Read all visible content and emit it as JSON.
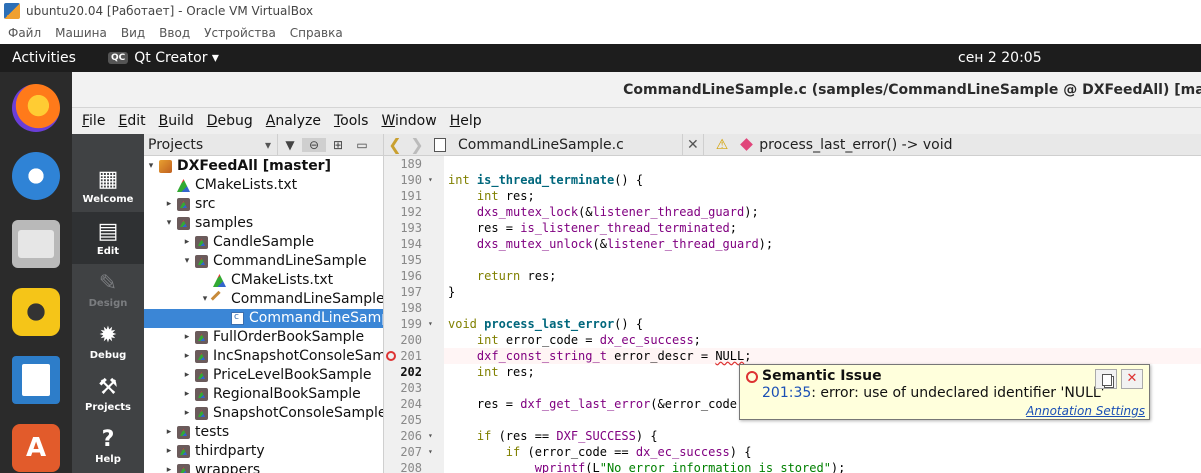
{
  "host_window": {
    "title": "ubuntu20.04 [Работает] - Oracle VM VirtualBox",
    "menu": [
      "Файл",
      "Машина",
      "Вид",
      "Ввод",
      "Устройства",
      "Справка"
    ]
  },
  "gnome_topbar": {
    "activities": "Activities",
    "app_badge": "QC",
    "app_name": "Qt Creator ▾",
    "clock": "сен 2  20:05"
  },
  "dock": {
    "items": [
      "firefox-icon",
      "thunderbird-icon",
      "files-icon",
      "rhythmbox-icon",
      "writer-icon",
      "software-icon"
    ],
    "software_glyph": "A"
  },
  "qt_window": {
    "title": "CommandLineSample.c (samples/CommandLineSample @ DXFeedAll) [mas",
    "menu": [
      "File",
      "Edit",
      "Build",
      "Debug",
      "Analyze",
      "Tools",
      "Window",
      "Help"
    ]
  },
  "modes": [
    {
      "label": "Welcome",
      "glyph": "▦"
    },
    {
      "label": "Edit",
      "glyph": "▤"
    },
    {
      "label": "Design",
      "glyph": "✎"
    },
    {
      "label": "Debug",
      "glyph": "✹"
    },
    {
      "label": "Projects",
      "glyph": "⚒"
    },
    {
      "label": "Help",
      "glyph": "?"
    }
  ],
  "projects": {
    "combo_label": "Projects",
    "toolbar_icons": [
      "filter-icon",
      "link-icon",
      "split-icon",
      "close-pane-icon"
    ],
    "tree": [
      {
        "label": "DXFeedAll [master]",
        "depth": 0,
        "arrow": "▾",
        "icon": "project"
      },
      {
        "label": "CMakeLists.txt",
        "depth": 1,
        "arrow": "",
        "icon": "cmake"
      },
      {
        "label": "src",
        "depth": 1,
        "arrow": "▸",
        "icon": "folder"
      },
      {
        "label": "samples",
        "depth": 1,
        "arrow": "▾",
        "icon": "folder"
      },
      {
        "label": "CandleSample",
        "depth": 2,
        "arrow": "▸",
        "icon": "folder"
      },
      {
        "label": "CommandLineSample",
        "depth": 2,
        "arrow": "▾",
        "icon": "folder"
      },
      {
        "label": "CMakeLists.txt",
        "depth": 3,
        "arrow": "",
        "icon": "cmake"
      },
      {
        "label": "CommandLineSample",
        "depth": 3,
        "arrow": "▾",
        "icon": "target"
      },
      {
        "label": "CommandLineSamp",
        "depth": 4,
        "arrow": "",
        "icon": "cfile",
        "selected": true
      },
      {
        "label": "FullOrderBookSample",
        "depth": 2,
        "arrow": "▸",
        "icon": "folder"
      },
      {
        "label": "IncSnapshotConsoleSam",
        "depth": 2,
        "arrow": "▸",
        "icon": "folder"
      },
      {
        "label": "PriceLevelBookSample",
        "depth": 2,
        "arrow": "▸",
        "icon": "folder"
      },
      {
        "label": "RegionalBookSample",
        "depth": 2,
        "arrow": "▸",
        "icon": "folder"
      },
      {
        "label": "SnapshotConsoleSample",
        "depth": 2,
        "arrow": "▸",
        "icon": "folder"
      },
      {
        "label": "tests",
        "depth": 1,
        "arrow": "▸",
        "icon": "folder"
      },
      {
        "label": "thirdparty",
        "depth": 1,
        "arrow": "▸",
        "icon": "folder"
      },
      {
        "label": "wrappers",
        "depth": 1,
        "arrow": "▸",
        "icon": "folder"
      }
    ]
  },
  "editor_toolbar": {
    "back": "❮",
    "forward": "❯",
    "document": "CommandLineSample.c",
    "close": "✕",
    "warning": "⚠",
    "symbol": "process_last_error() -> void"
  },
  "editor": {
    "current_line": 202,
    "error_line": 201,
    "lines": [
      {
        "n": 189,
        "fold": "",
        "segs": []
      },
      {
        "n": 190,
        "fold": "▾",
        "segs": [
          [
            "kw",
            "int "
          ],
          [
            "fn",
            "is_thread_terminate"
          ],
          [
            "",
            "() {"
          ]
        ]
      },
      {
        "n": 191,
        "fold": "",
        "segs": [
          [
            "",
            "    "
          ],
          [
            "kw",
            "int"
          ],
          [
            "",
            " res;"
          ]
        ]
      },
      {
        "n": 192,
        "fold": "",
        "segs": [
          [
            "",
            "    "
          ],
          [
            "id",
            "dxs_mutex_lock"
          ],
          [
            "",
            "(&"
          ],
          [
            "id",
            "listener_thread_guard"
          ],
          [
            "",
            ");"
          ]
        ]
      },
      {
        "n": 193,
        "fold": "",
        "segs": [
          [
            "",
            "    res = "
          ],
          [
            "id",
            "is_listener_thread_terminated"
          ],
          [
            "",
            ";"
          ]
        ]
      },
      {
        "n": 194,
        "fold": "",
        "segs": [
          [
            "",
            "    "
          ],
          [
            "id",
            "dxs_mutex_unlock"
          ],
          [
            "",
            "(&"
          ],
          [
            "id",
            "listener_thread_guard"
          ],
          [
            "",
            ");"
          ]
        ]
      },
      {
        "n": 195,
        "fold": "",
        "segs": []
      },
      {
        "n": 196,
        "fold": "",
        "segs": [
          [
            "",
            "    "
          ],
          [
            "kw",
            "return"
          ],
          [
            "",
            " res;"
          ]
        ]
      },
      {
        "n": 197,
        "fold": "",
        "segs": [
          [
            "",
            "}"
          ]
        ]
      },
      {
        "n": 198,
        "fold": "",
        "segs": []
      },
      {
        "n": 199,
        "fold": "▾",
        "segs": [
          [
            "kw",
            "void "
          ],
          [
            "fn",
            "process_last_error"
          ],
          [
            "",
            "() {"
          ]
        ]
      },
      {
        "n": 200,
        "fold": "",
        "segs": [
          [
            "",
            "    "
          ],
          [
            "kw",
            "int"
          ],
          [
            "",
            " error_code = "
          ],
          [
            "id",
            "dx_ec_success"
          ],
          [
            "",
            ";"
          ]
        ]
      },
      {
        "n": 201,
        "fold": "",
        "segs": [
          [
            "",
            "    "
          ],
          [
            "id",
            "dxf_const_string_t"
          ],
          [
            "",
            " error_descr = "
          ],
          [
            "err",
            "NULL"
          ],
          [
            "",
            ";"
          ]
        ]
      },
      {
        "n": 202,
        "fold": "",
        "segs": [
          [
            "",
            "    "
          ],
          [
            "kw",
            "int"
          ],
          [
            "",
            " res;"
          ]
        ]
      },
      {
        "n": 203,
        "fold": "",
        "segs": []
      },
      {
        "n": 204,
        "fold": "",
        "segs": [
          [
            "",
            "    res = "
          ],
          [
            "id",
            "dxf_get_last_error"
          ],
          [
            "",
            "(&error_code,"
          ]
        ]
      },
      {
        "n": 205,
        "fold": "",
        "segs": []
      },
      {
        "n": 206,
        "fold": "▾",
        "segs": [
          [
            "",
            "    "
          ],
          [
            "kw",
            "if"
          ],
          [
            "",
            " (res == "
          ],
          [
            "id",
            "DXF_SUCCESS"
          ],
          [
            "",
            ") {"
          ]
        ]
      },
      {
        "n": 207,
        "fold": "▾",
        "segs": [
          [
            "",
            "        "
          ],
          [
            "kw",
            "if"
          ],
          [
            "",
            " (error_code == "
          ],
          [
            "id",
            "dx_ec_success"
          ],
          [
            "",
            ") {"
          ]
        ]
      },
      {
        "n": 208,
        "fold": "",
        "segs": [
          [
            "",
            "            "
          ],
          [
            "id",
            "wprintf"
          ],
          [
            "",
            "(L"
          ],
          [
            "str",
            "\"No error information is stored\""
          ],
          [
            "",
            ");"
          ]
        ]
      }
    ]
  },
  "tooltip": {
    "heading": "Semantic Issue",
    "location": "201:35",
    "message": ": error: use of undeclared identifier 'NULL'",
    "settings_link": "Annotation Settings",
    "close": "✕"
  }
}
